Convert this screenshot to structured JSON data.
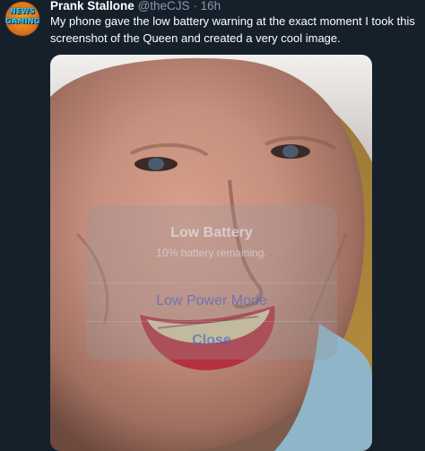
{
  "tweet": {
    "author": {
      "display_name": "Prank Stallone",
      "handle": "@theCJS",
      "separator": "·",
      "timestamp": "16h",
      "avatar_lines": [
        "NEWS",
        "GAMING"
      ]
    },
    "text": "My phone gave the low battery warning at the exact moment I took this screenshot of the Queen and created a very cool image."
  },
  "media": {
    "alert": {
      "title": "Low Battery",
      "message": "10% battery remaining.",
      "buttons": [
        "Low Power Mode",
        "Close"
      ]
    }
  },
  "colors": {
    "background": "#15202b",
    "primary_text": "#ffffff",
    "secondary_text": "#8899a6",
    "alert_button": "#465fc8"
  }
}
